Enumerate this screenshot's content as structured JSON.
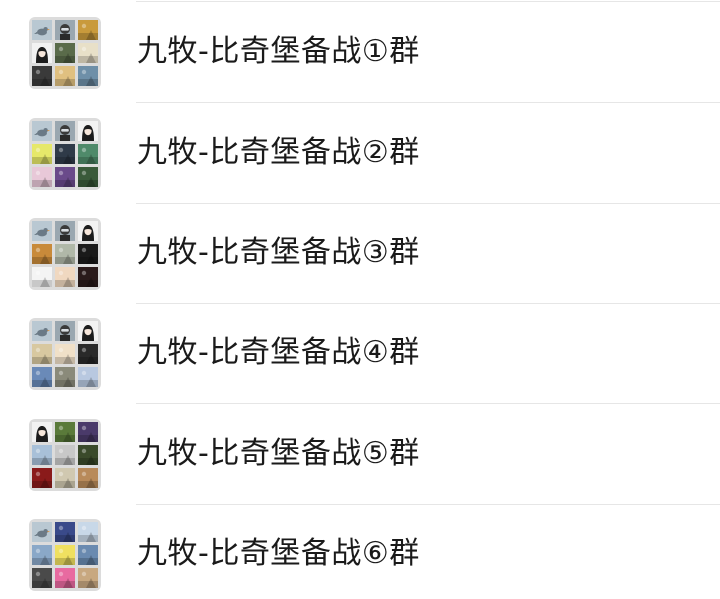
{
  "chats": [
    {
      "name": "九牧-比奇堡备战①群",
      "tiles": [
        {
          "kind": "bird",
          "color": "#b9c8d2"
        },
        {
          "kind": "mask",
          "color": "#9aa7b0"
        },
        {
          "kind": "scene",
          "color": "#c99a3c"
        },
        {
          "kind": "girl",
          "color": "#f2f2f2"
        },
        {
          "kind": "scene",
          "color": "#5a6b4a"
        },
        {
          "kind": "scene",
          "color": "#e8e0c8"
        },
        {
          "kind": "scene",
          "color": "#3a3a3a"
        },
        {
          "kind": "scene",
          "color": "#e0c080"
        },
        {
          "kind": "scene",
          "color": "#6e8fa8"
        }
      ]
    },
    {
      "name": "九牧-比奇堡备战②群",
      "tiles": [
        {
          "kind": "bird",
          "color": "#b9c8d2"
        },
        {
          "kind": "mask",
          "color": "#9aa7b0"
        },
        {
          "kind": "girl",
          "color": "#f2f2f2"
        },
        {
          "kind": "scene",
          "color": "#e6e86a"
        },
        {
          "kind": "scene",
          "color": "#2f3a48"
        },
        {
          "kind": "scene",
          "color": "#4f8a6a"
        },
        {
          "kind": "scene",
          "color": "#e8c8d8"
        },
        {
          "kind": "scene",
          "color": "#6a4a8a"
        },
        {
          "kind": "scene",
          "color": "#3a5a3a"
        }
      ]
    },
    {
      "name": "九牧-比奇堡备战③群",
      "tiles": [
        {
          "kind": "bird",
          "color": "#b9c8d2"
        },
        {
          "kind": "mask",
          "color": "#9aa7b0"
        },
        {
          "kind": "girl",
          "color": "#f2f2f2"
        },
        {
          "kind": "scene",
          "color": "#c88a3a"
        },
        {
          "kind": "scene",
          "color": "#b0b8a8"
        },
        {
          "kind": "scene",
          "color": "#1a1a1a"
        },
        {
          "kind": "scene",
          "color": "#f4f4f4"
        },
        {
          "kind": "scene",
          "color": "#f0d8c0"
        },
        {
          "kind": "scene",
          "color": "#2a1a1a"
        }
      ]
    },
    {
      "name": "九牧-比奇堡备战④群",
      "tiles": [
        {
          "kind": "bird",
          "color": "#b9c8d2"
        },
        {
          "kind": "mask",
          "color": "#9aa7b0"
        },
        {
          "kind": "girl",
          "color": "#f2f2f2"
        },
        {
          "kind": "scene",
          "color": "#d8c8a0"
        },
        {
          "kind": "scene",
          "color": "#f0e0c8"
        },
        {
          "kind": "scene",
          "color": "#2a2a2a"
        },
        {
          "kind": "scene",
          "color": "#6a8ab8"
        },
        {
          "kind": "scene",
          "color": "#8a8a7a"
        },
        {
          "kind": "scene",
          "color": "#b8c8e0"
        }
      ]
    },
    {
      "name": "九牧-比奇堡备战⑤群",
      "tiles": [
        {
          "kind": "girl",
          "color": "#f2f2f2"
        },
        {
          "kind": "scene",
          "color": "#5a7a3a"
        },
        {
          "kind": "scene",
          "color": "#4a3a6a"
        },
        {
          "kind": "scene",
          "color": "#a8c0d8"
        },
        {
          "kind": "scene",
          "color": "#c8c8c8"
        },
        {
          "kind": "scene",
          "color": "#3a4a2a"
        },
        {
          "kind": "scene",
          "color": "#8a1a1a"
        },
        {
          "kind": "scene",
          "color": "#d0c8b0"
        },
        {
          "kind": "scene",
          "color": "#b88a5a"
        }
      ]
    },
    {
      "name": "九牧-比奇堡备战⑥群",
      "tiles": [
        {
          "kind": "bird",
          "color": "#b9c8d2"
        },
        {
          "kind": "scene",
          "color": "#3a4a8a"
        },
        {
          "kind": "scene",
          "color": "#c8d8e8"
        },
        {
          "kind": "scene",
          "color": "#8aa8c8"
        },
        {
          "kind": "scene",
          "color": "#f0e060"
        },
        {
          "kind": "scene",
          "color": "#6a8ab0"
        },
        {
          "kind": "scene",
          "color": "#4a4a4a"
        },
        {
          "kind": "scene",
          "color": "#e86aa0"
        },
        {
          "kind": "scene",
          "color": "#c8a880"
        }
      ]
    }
  ]
}
